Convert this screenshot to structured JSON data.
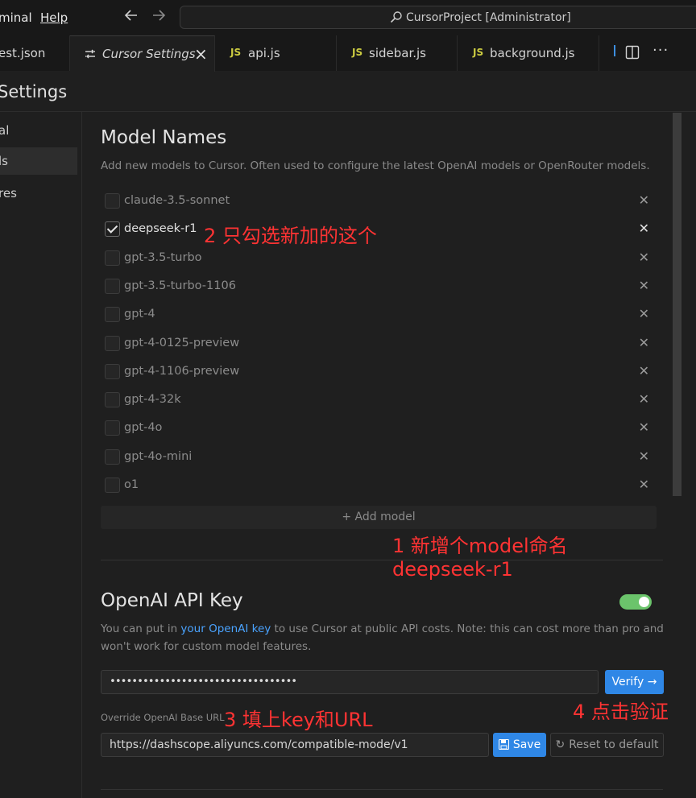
{
  "menu": {
    "terminal": "minal",
    "help": "Help"
  },
  "command_center": {
    "label": "CursorProject [Administrator]"
  },
  "tabs": [
    {
      "label": "est.json"
    },
    {
      "label": "Cursor Settings",
      "close": "×"
    },
    {
      "label": "api.js",
      "badge": "JS"
    },
    {
      "label": "sidebar.js",
      "badge": "JS"
    },
    {
      "label": "background.js",
      "badge": "JS"
    }
  ],
  "settings": {
    "title": "Settings"
  },
  "nav": [
    {
      "label": "al"
    },
    {
      "label": "ls"
    },
    {
      "label": "res"
    }
  ],
  "models_section": {
    "title": "Model Names",
    "description": "Add new models to Cursor. Often used to configure the latest OpenAI models or OpenRouter models.",
    "models": [
      {
        "name": "claude-3.5-sonnet",
        "checked": false
      },
      {
        "name": "deepseek-r1",
        "checked": true
      },
      {
        "name": "gpt-3.5-turbo",
        "checked": false
      },
      {
        "name": "gpt-3.5-turbo-1106",
        "checked": false
      },
      {
        "name": "gpt-4",
        "checked": false
      },
      {
        "name": "gpt-4-0125-preview",
        "checked": false
      },
      {
        "name": "gpt-4-1106-preview",
        "checked": false
      },
      {
        "name": "gpt-4-32k",
        "checked": false
      },
      {
        "name": "gpt-4o",
        "checked": false
      },
      {
        "name": "gpt-4o-mini",
        "checked": false
      },
      {
        "name": "o1",
        "checked": false
      }
    ],
    "add_model_label": "+ Add model"
  },
  "openai_section": {
    "title": "OpenAI API Key",
    "toggle_enabled": true,
    "desc_part1": "You can put in ",
    "desc_link": "your OpenAI key",
    "desc_part2": " to use Cursor at public API costs. Note: this can cost more than pro and won't work for custom model features.",
    "api_key_value": "••••••••••••••••••••••••••••••••••",
    "verify_label": "Verify →",
    "base_url_label": "Override OpenAI Base URL",
    "base_url_value": "https://dashscope.aliyuncs.com/compatible-mode/v1",
    "save_label": "Save",
    "reset_label": "Reset to default"
  },
  "annotations": {
    "a1_line1": "1 新增个model命名",
    "a1_line2": "deepseek-r1",
    "a2": "2 只勾选新加的这个",
    "a3": "3 填上key和URL",
    "a4": "4 点击验证"
  },
  "colors": {
    "accent": "#2f87e6",
    "toggle_on": "#6bc46b",
    "annotation": "#ff3333",
    "link": "#4aa3ff"
  }
}
